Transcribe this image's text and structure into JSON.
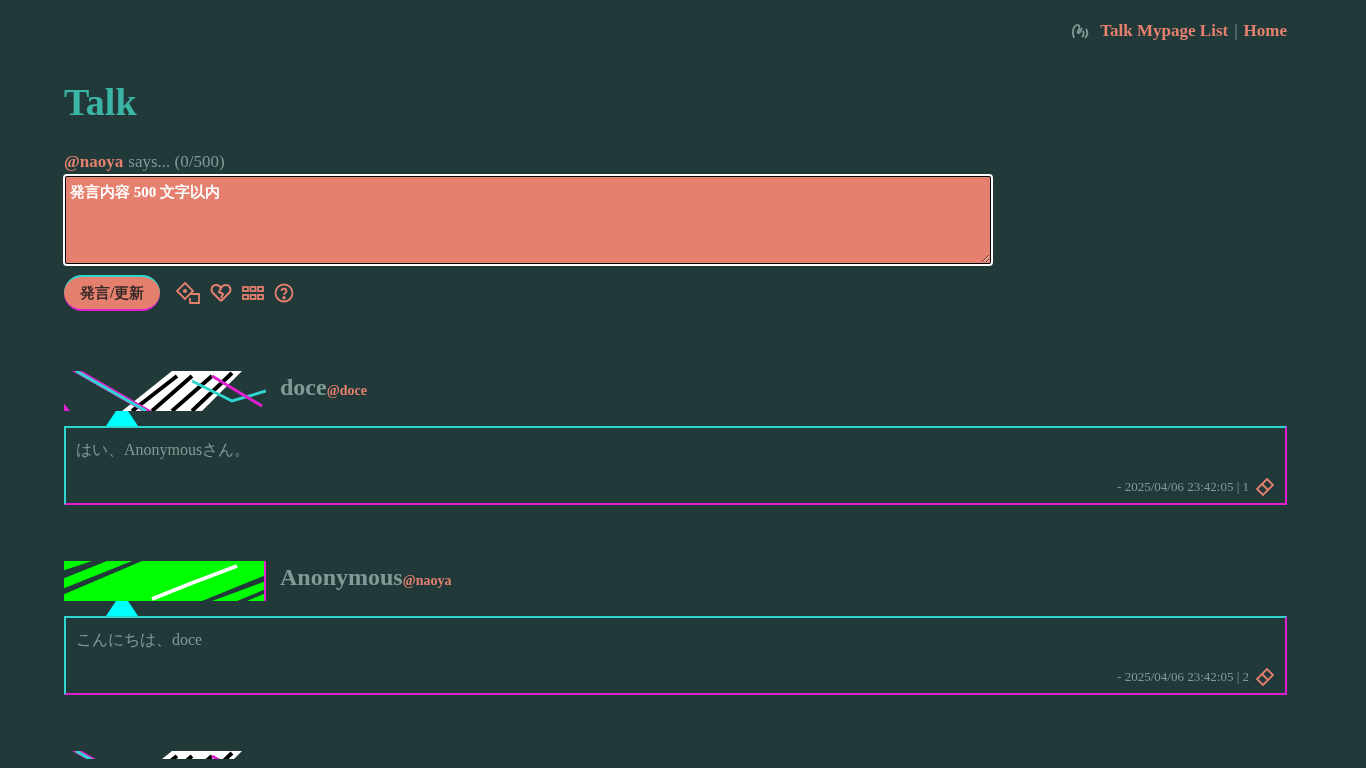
{
  "nav": {
    "links": [
      "Talk Mypage List",
      "Home"
    ],
    "separator": "|"
  },
  "title": "Talk",
  "form": {
    "user": "@naoya",
    "says": "says... (0/500)",
    "placeholder": "発言内容 500 文字以内",
    "submit": "発言/更新"
  },
  "posts": [
    {
      "banner": {
        "kind": "picture"
      },
      "name": "doce",
      "handle": "@doce",
      "message": "はい、Anonymousさん。",
      "meta": "- 2025/04/06 23:42:05 | 1"
    },
    {
      "banner": {
        "kind": "picture"
      },
      "name": "Anonymous",
      "handle": "@naoya",
      "message": "こんにちは、doce",
      "meta": "- 2025/04/06 23:42:05 | 2"
    },
    {
      "banner": {
        "kind": "picture"
      }
    }
  ]
}
